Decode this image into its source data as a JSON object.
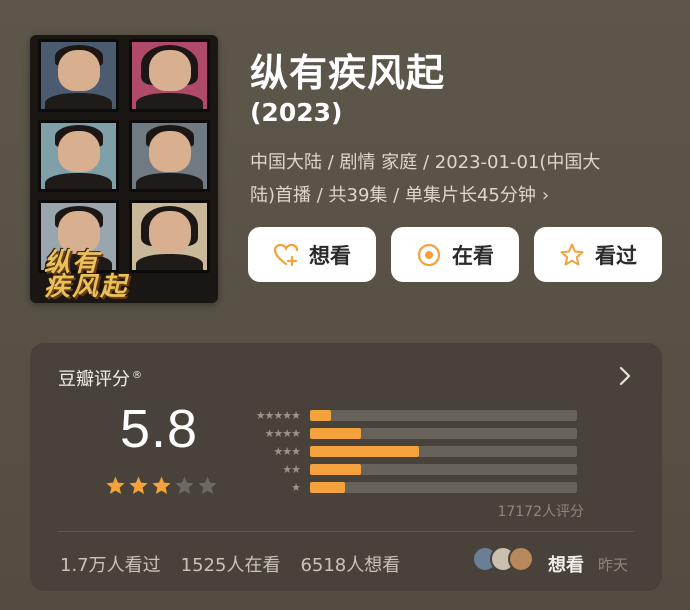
{
  "poster": {
    "title_art": "纵有\n疾风起",
    "portrait_tones": [
      "#4b5b70",
      "#b04a6a",
      "#7fa0a8",
      "#707a82",
      "#9aa6ad",
      "#c9b89a"
    ]
  },
  "show": {
    "title": "纵有疾风起",
    "year": "(2023)",
    "meta_line1": "中国大陆 / 剧情 家庭 / 2023-01-01(中国大",
    "meta_line2": "陆)首播 / 共39集 / 单集片长45分钟",
    "meta_chevron": "›"
  },
  "actions": {
    "want": {
      "label": "想看",
      "icon": "heart-plus-icon"
    },
    "watching": {
      "label": "在看",
      "icon": "target-circle-icon"
    },
    "watched": {
      "label": "看过",
      "icon": "star-outline-icon"
    },
    "icon_color": "#f3a23c"
  },
  "rating": {
    "label": "豆瓣评分",
    "label_mark": "®",
    "more_icon": "chevron-right-icon",
    "score": "5.8",
    "stars_filled": 3,
    "stars_total": 5,
    "distribution": [
      {
        "stars": 5,
        "label": "★★★★★",
        "fraction": 0.08
      },
      {
        "stars": 4,
        "label": "★★★★",
        "fraction": 0.19
      },
      {
        "stars": 3,
        "label": "★★★",
        "fraction": 0.41
      },
      {
        "stars": 2,
        "label": "★★",
        "fraction": 0.19
      },
      {
        "stars": 1,
        "label": "★",
        "fraction": 0.13
      }
    ],
    "votes": "17172人评分",
    "watched_count": "1.7万人看过",
    "watching_count": "1525人在看",
    "want_count": "6518人想看",
    "friends_action": "想看",
    "friends_time": "昨天",
    "accent": "#f3a23c",
    "avatar_colors": [
      "#6a7f96",
      "#c9c0b0",
      "#b8875c"
    ]
  }
}
